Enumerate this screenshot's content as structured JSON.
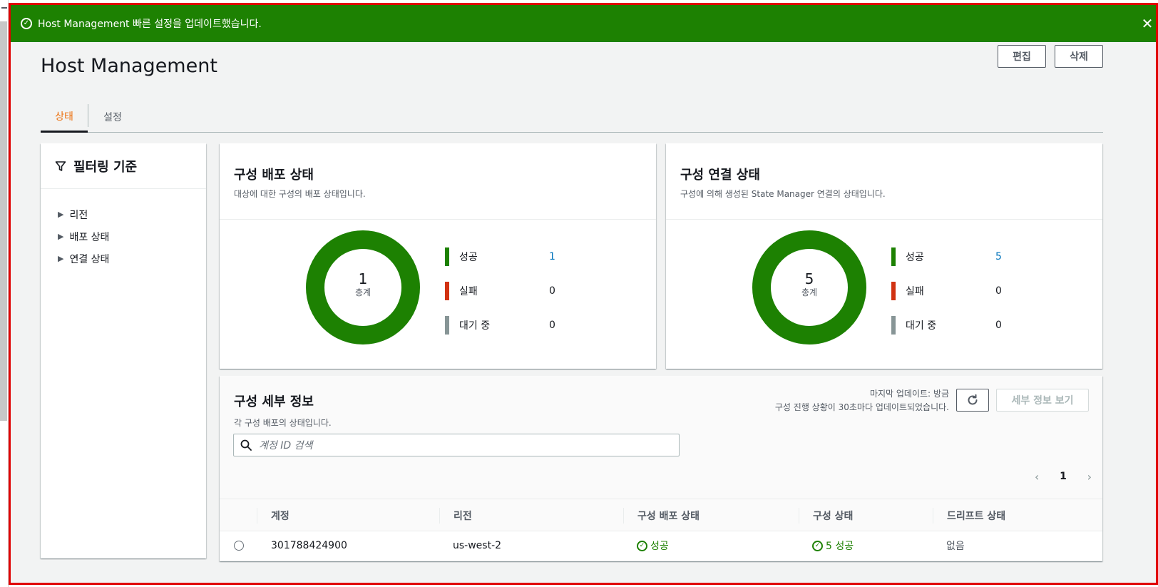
{
  "flash": {
    "message": "Host Management 빠른 설정을 업데이트했습니다.",
    "color": "#1d8102"
  },
  "page": {
    "title": "Host Management",
    "edit_label": "편집",
    "delete_label": "삭제"
  },
  "tabs": [
    {
      "label": "상태",
      "active": true
    },
    {
      "label": "설정",
      "active": false
    }
  ],
  "filter": {
    "title": "필터링 기준",
    "items": [
      {
        "label": "리전"
      },
      {
        "label": "배포 상태"
      },
      {
        "label": "연결 상태"
      }
    ]
  },
  "deployment": {
    "title": "구성 배포 상태",
    "description": "대상에 대한 구성의 배포 상태입니다.",
    "total": "1",
    "total_label": "총계",
    "legend": [
      {
        "label": "성공",
        "value": "1",
        "color": "#1d8102"
      },
      {
        "label": "실패",
        "value": "0",
        "color": "#d13212"
      },
      {
        "label": "대기 중",
        "value": "0",
        "color": "#879596"
      }
    ]
  },
  "association": {
    "title": "구성 연결 상태",
    "description": "구성에 의해 생성된 State Manager 연결의 상태입니다.",
    "total": "5",
    "total_label": "총계",
    "legend": [
      {
        "label": "성공",
        "value": "5",
        "color": "#1d8102"
      },
      {
        "label": "실패",
        "value": "0",
        "color": "#d13212"
      },
      {
        "label": "대기 중",
        "value": "0",
        "color": "#879596"
      }
    ]
  },
  "details": {
    "title": "구성 세부 정보",
    "description": "각 구성 배포의 상태입니다.",
    "last_updated": "마지막 업데이트: 방금",
    "update_note": "구성 진행 상황이 30초마다 업데이트되었습니다.",
    "view_details_label": "세부 정보 보기",
    "search_placeholder": "계정 ID 검색",
    "page": "1",
    "columns": [
      "계정",
      "리전",
      "구성 배포 상태",
      "구성 상태",
      "드리프트 상태"
    ],
    "rows": [
      {
        "account": "301788424900",
        "region": "us-west-2",
        "deploy_status": "성공",
        "config_status": "5 성공",
        "drift": "없음"
      }
    ]
  }
}
